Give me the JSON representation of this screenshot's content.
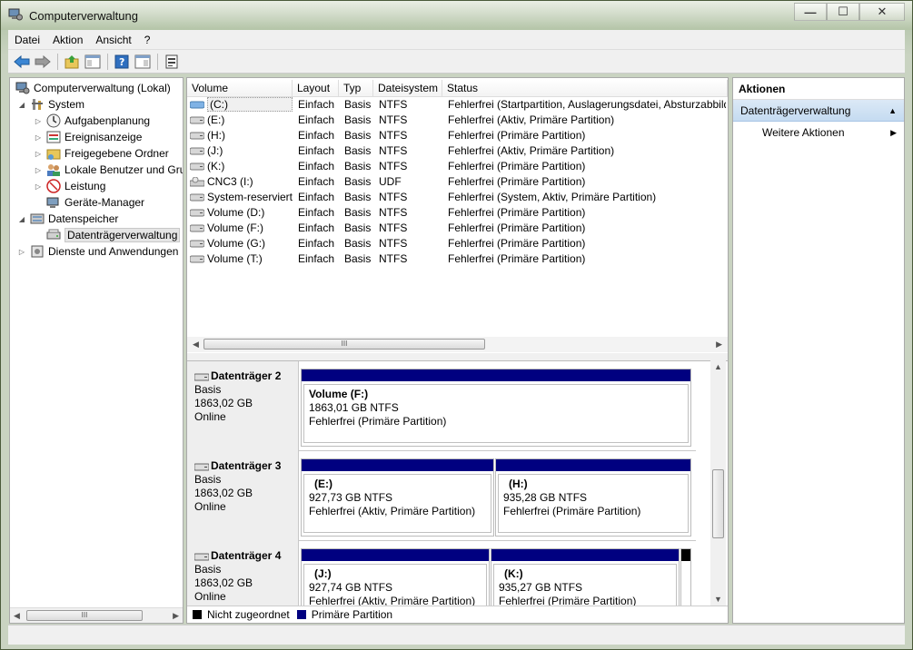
{
  "window": {
    "title": "Computerverwaltung",
    "minimize": "—",
    "maximize": "☐",
    "close": "✕"
  },
  "menu": [
    "Datei",
    "Aktion",
    "Ansicht",
    "?"
  ],
  "tree": {
    "root": "Computerverwaltung (Lokal)",
    "system": "System",
    "items": [
      "Aufgabenplanung",
      "Ereignisanzeige",
      "Freigegebene Ordner",
      "Lokale Benutzer und Gruppen",
      "Leistung",
      "Geräte-Manager"
    ],
    "storage": "Datenspeicher",
    "disk_mgmt": "Datenträgerverwaltung",
    "services": "Dienste und Anwendungen",
    "scroll_thumb": "III"
  },
  "columns": [
    "Volume",
    "Layout",
    "Typ",
    "Dateisystem",
    "Status"
  ],
  "volumes": [
    [
      "(C:)",
      "Einfach",
      "Basis",
      "NTFS",
      "Fehlerfrei (Startpartition, Auslagerungsdatei, Absturzabbild"
    ],
    [
      "(E:)",
      "Einfach",
      "Basis",
      "NTFS",
      "Fehlerfrei (Aktiv, Primäre Partition)"
    ],
    [
      "(H:)",
      "Einfach",
      "Basis",
      "NTFS",
      "Fehlerfrei (Primäre Partition)"
    ],
    [
      "(J:)",
      "Einfach",
      "Basis",
      "NTFS",
      "Fehlerfrei (Aktiv, Primäre Partition)"
    ],
    [
      "(K:)",
      "Einfach",
      "Basis",
      "NTFS",
      "Fehlerfrei (Primäre Partition)"
    ],
    [
      "CNC3 (I:)",
      "Einfach",
      "Basis",
      "UDF",
      "Fehlerfrei (Primäre Partition)"
    ],
    [
      "System-reserviert",
      "Einfach",
      "Basis",
      "NTFS",
      "Fehlerfrei (System, Aktiv, Primäre Partition)"
    ],
    [
      "Volume (D:)",
      "Einfach",
      "Basis",
      "NTFS",
      "Fehlerfrei (Primäre Partition)"
    ],
    [
      "Volume (F:)",
      "Einfach",
      "Basis",
      "NTFS",
      "Fehlerfrei (Primäre Partition)"
    ],
    [
      "Volume (G:)",
      "Einfach",
      "Basis",
      "NTFS",
      "Fehlerfrei (Primäre Partition)"
    ],
    [
      "Volume (T:)",
      "Einfach",
      "Basis",
      "NTFS",
      "Fehlerfrei (Primäre Partition)"
    ]
  ],
  "list_scroll_thumb": "III",
  "disks": [
    {
      "name": "Datenträger 2",
      "type": "Basis",
      "size": "1863,02 GB",
      "state": "Online",
      "partitions": [
        {
          "name": "Volume  (F:)",
          "size": "1863,01 GB NTFS",
          "status": "Fehlerfrei (Primäre Partition)"
        }
      ]
    },
    {
      "name": "Datenträger 3",
      "type": "Basis",
      "size": "1863,02 GB",
      "state": "Online",
      "partitions": [
        {
          "name": "(E:)",
          "size": "927,73 GB NTFS",
          "status": "Fehlerfrei (Aktiv, Primäre Partition)"
        },
        {
          "name": "(H:)",
          "size": "935,28 GB NTFS",
          "status": "Fehlerfrei (Primäre Partition)"
        }
      ]
    },
    {
      "name": "Datenträger 4",
      "type": "Basis",
      "size": "1863,02 GB",
      "state": "Online",
      "partitions": [
        {
          "name": "(J:)",
          "size": "927,74 GB NTFS",
          "status": "Fehlerfrei (Aktiv, Primäre Partition)"
        },
        {
          "name": "(K:)",
          "size": "935,27 GB NTFS",
          "status": "Fehlerfrei (Primäre Partition)"
        }
      ]
    }
  ],
  "legend": [
    "Nicht zugeordnet",
    "Primäre Partition"
  ],
  "colors": {
    "primary_partition": "#000080",
    "unallocated": "#000000",
    "selection": "#c5dbf1"
  },
  "actions": {
    "title": "Aktionen",
    "section": "Datenträgerverwaltung",
    "more": "Weitere Aktionen"
  }
}
